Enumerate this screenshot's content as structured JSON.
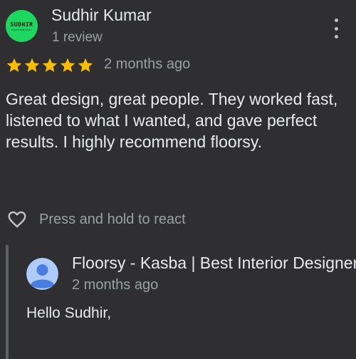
{
  "review": {
    "reviewer": {
      "name": "Sudhir Kumar",
      "review_count": "1 review",
      "avatar_text": "SUDHIR",
      "avatar_subtext": "PHOTOGRAPHY",
      "avatar_color": "#1ed760"
    },
    "rating": 5,
    "rating_max": 5,
    "star_color": "#fbbc04",
    "date": "2 months ago",
    "text": "Great design, great people. They worked fast, listened to what I wanted, and gave perfect results. I highly recommend floorsy.",
    "react_label": "Press and hold to react",
    "icons": {
      "more": "more-vert-icon",
      "react": "heart-outline-icon",
      "star": "star-icon",
      "owner_avatar": "person-avatar-icon"
    }
  },
  "owner_reply": {
    "name": "Floorsy - Kasba | Best Interior Designers",
    "date": "2 months ago",
    "text": "Hello Sudhir,",
    "avatar_bg": "#aecbfa",
    "avatar_fg": "#4a7de0"
  }
}
